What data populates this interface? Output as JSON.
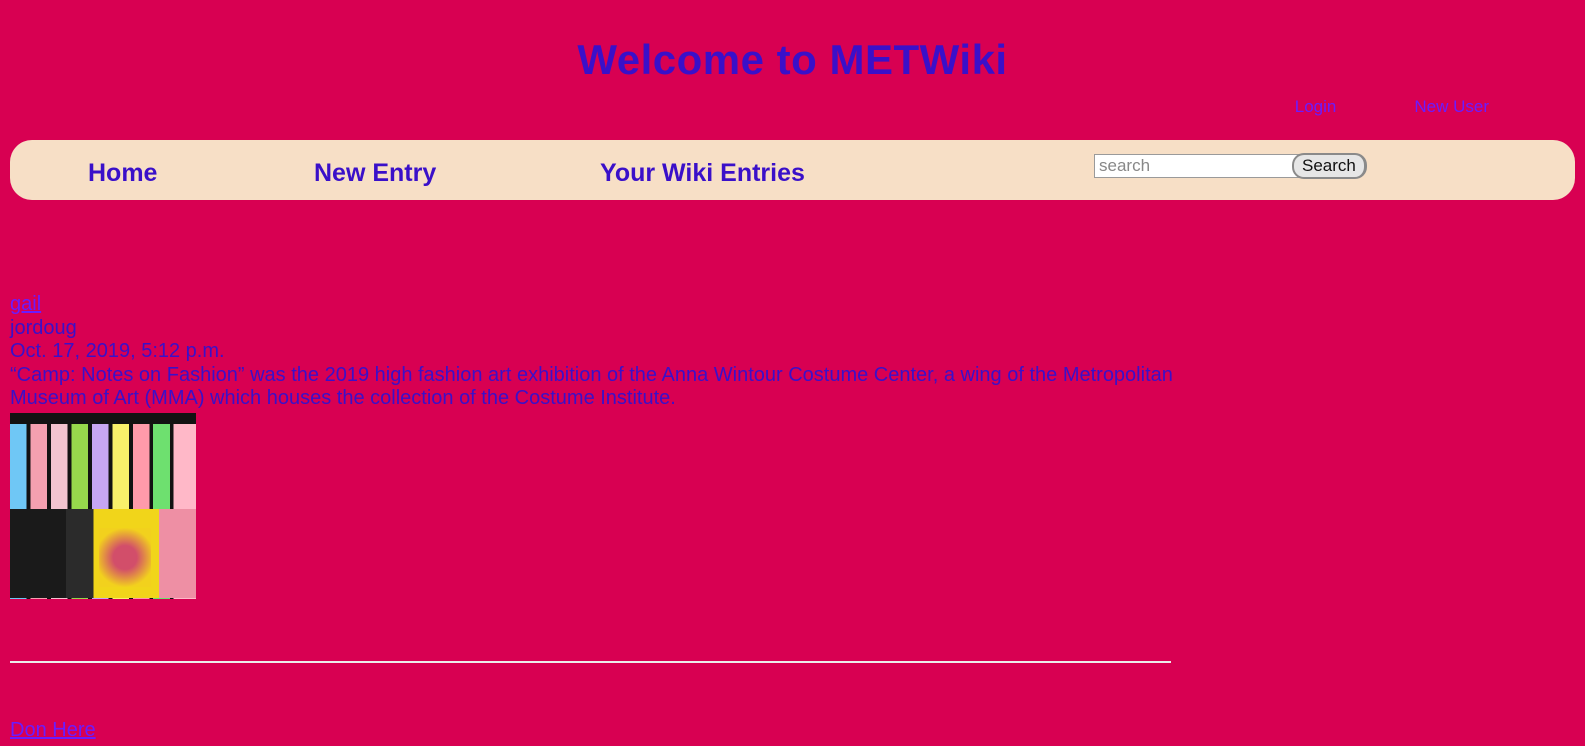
{
  "header": {
    "title": "Welcome to METWiki"
  },
  "auth": {
    "login": "Login",
    "new_user": "New User"
  },
  "nav": {
    "home": "Home",
    "new_entry": "New Entry",
    "your_entries": "Your Wiki Entries",
    "search_placeholder": "search",
    "search_button": "Search"
  },
  "entry": {
    "title": "gail",
    "author": "jordoug",
    "date": "Oct. 17, 2019, 5:12 p.m.",
    "description": "“Camp: Notes on Fashion” was the 2019 high fashion art exhibition of the Anna Wintour Costume Center, a wing of the Metropolitan Museum of Art (MMA) which houses the collection of the Costume Institute."
  },
  "next_entry": {
    "title": "Don Here"
  }
}
